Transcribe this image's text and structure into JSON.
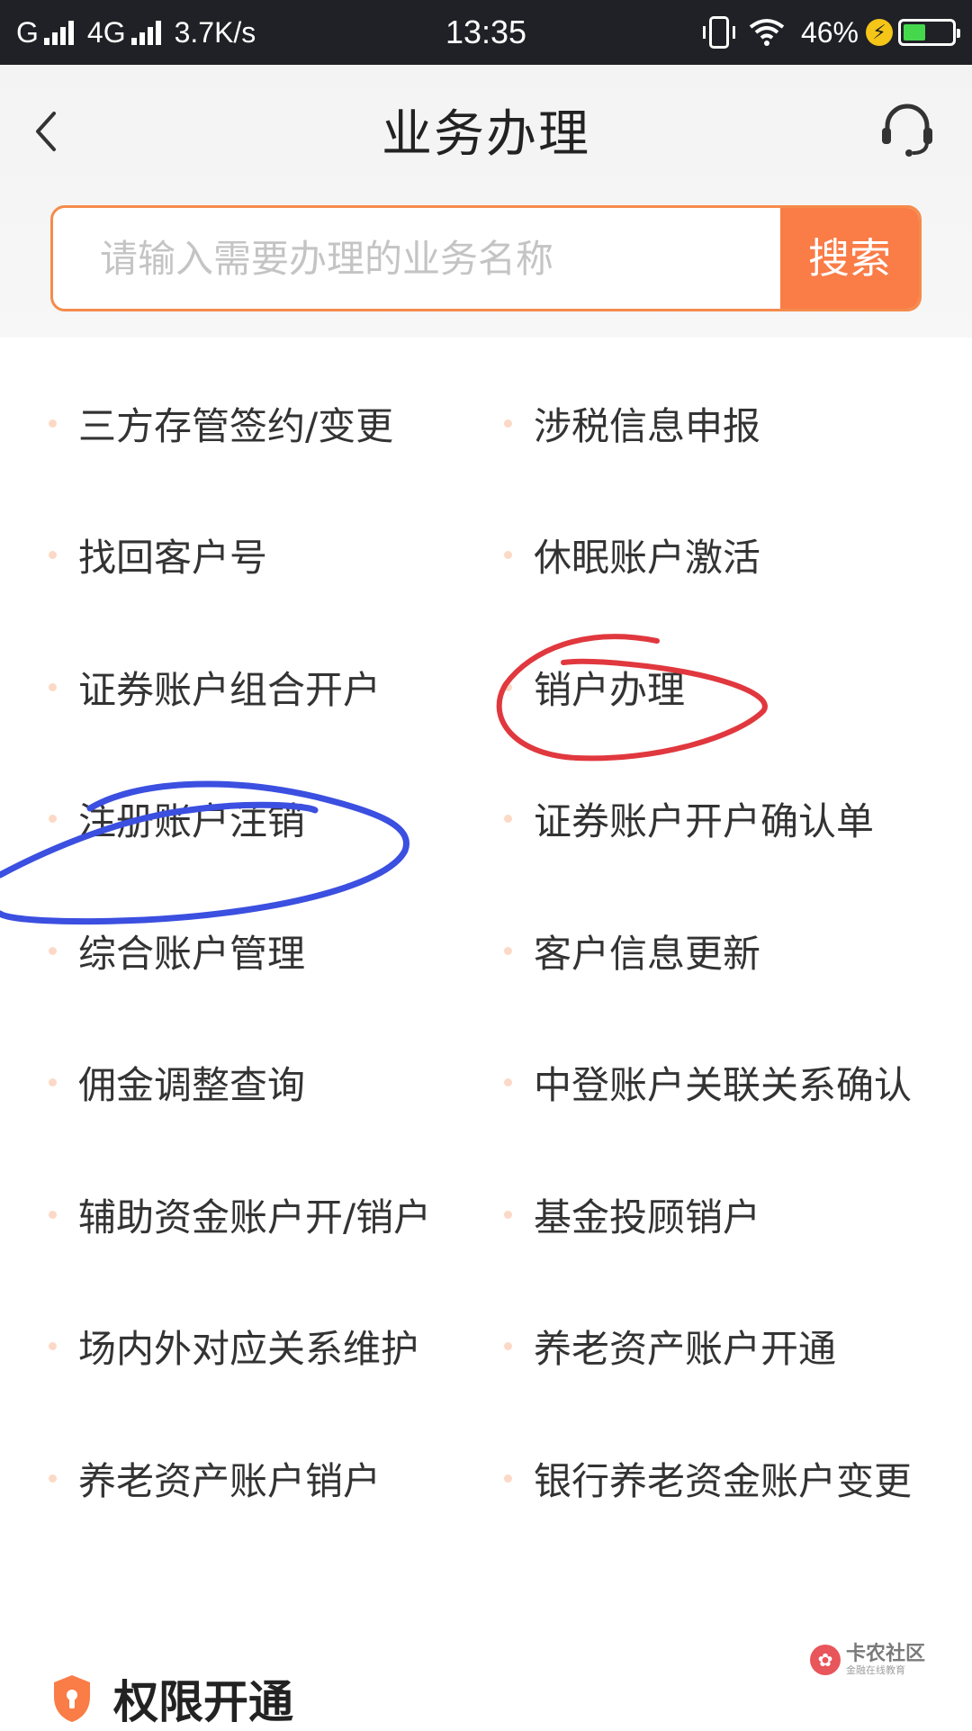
{
  "status_bar": {
    "carrier1": "G",
    "carrier2": "4G",
    "speed": "3.7K/s",
    "time": "13:35",
    "battery_percent": "46%",
    "battery_level": 0.46
  },
  "header": {
    "title": "业务办理",
    "back_icon": "chevron-left-icon",
    "support_icon": "headset-icon"
  },
  "search": {
    "placeholder": "请输入需要办理的业务名称",
    "value": "",
    "button_label": "搜索"
  },
  "services": [
    [
      "三方存管签约/变更",
      "涉税信息申报"
    ],
    [
      "找回客户号",
      "休眠账户激活"
    ],
    [
      "证券账户组合开户",
      "销户办理"
    ],
    [
      "注册账户注销",
      "证券账户开户确认单"
    ],
    [
      "综合账户管理",
      "客户信息更新"
    ],
    [
      "佣金调整查询",
      "中登账户关联关系确认"
    ],
    [
      "辅助资金账户开/销户",
      "基金投顾销户"
    ],
    [
      "场内外对应关系维护",
      "养老资产账户开通"
    ],
    [
      "养老资产账户销户",
      "银行养老资金账户变更"
    ]
  ],
  "section": {
    "title": "权限开通",
    "icon": "shield-icon"
  },
  "watermark": {
    "main": "卡农社区",
    "sub": "金融在线教育"
  },
  "colors": {
    "accent": "#fa7c47",
    "search_border": "#f58b4b",
    "dot": "#fcd9c6",
    "red_mark": "#e0383e",
    "blue_mark": "#3b4fe0"
  }
}
